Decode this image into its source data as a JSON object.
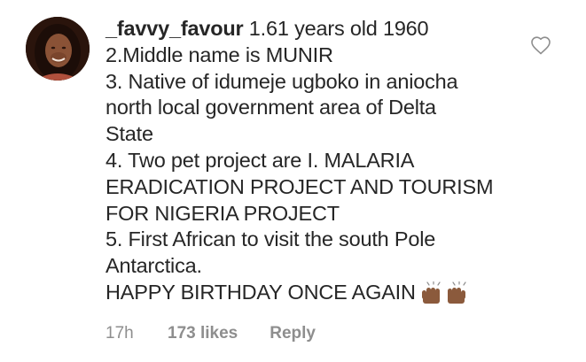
{
  "comment": {
    "username": "_favvy_favour",
    "first_line_text": " 1.61 years old 1960",
    "lines": [
      "2.Middle name is MUNIR",
      "3. Native of idumeje ugboko in aniocha",
      "north local government area of Delta",
      "State",
      "4. Two pet project are I. MALARIA",
      "ERADICATION PROJECT AND TOURISM",
      "FOR NIGERIA PROJECT",
      "5. First African to visit the south Pole",
      "Antarctica."
    ],
    "last_line": "HAPPY BIRTHDAY ONCE AGAIN",
    "emoji": "raising-hands-emoji",
    "time": "17h",
    "likes": "173 likes",
    "reply": "Reply"
  },
  "icons": {
    "heart": "heart-outline-icon",
    "avatar": "profile-photo"
  },
  "colors": {
    "text": "#262626",
    "meta": "#8e8e8e",
    "icon": "#8e8e8e"
  }
}
